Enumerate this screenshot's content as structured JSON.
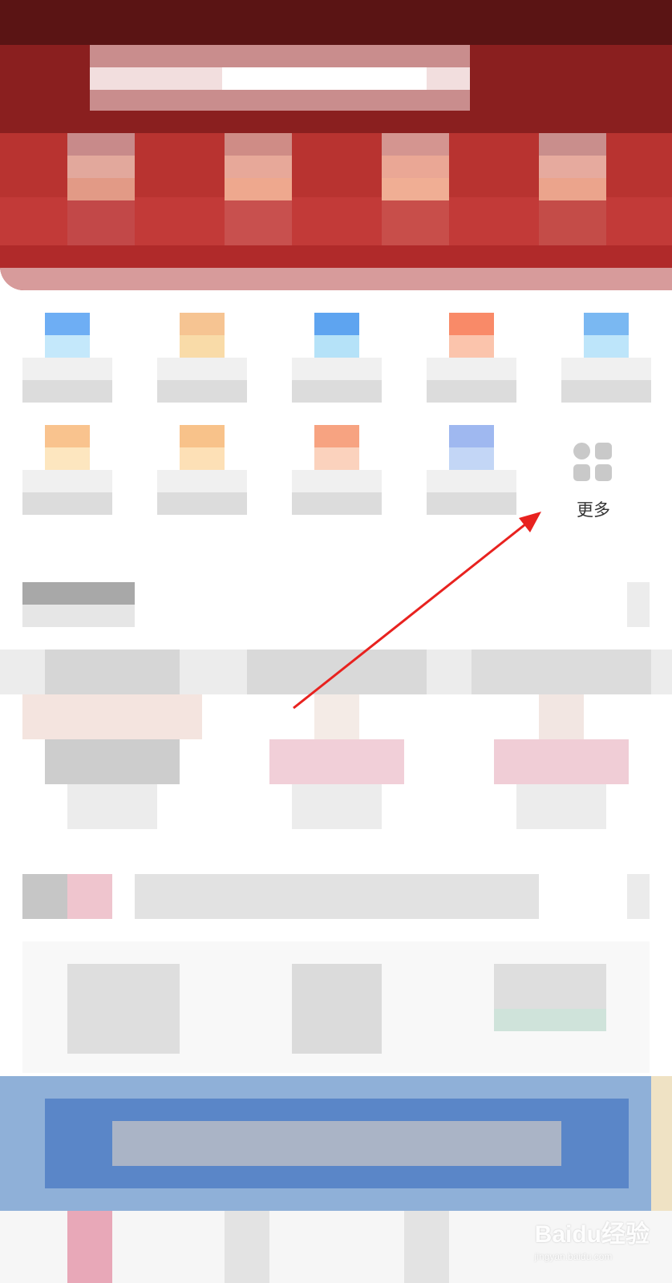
{
  "more": {
    "label": "更多",
    "icon": "grid-apps-icon"
  },
  "annotation": {
    "icon": "red-arrow-icon",
    "color": "#e8221f"
  },
  "watermark": {
    "brand": "Baidu经验",
    "url": "jingyan.baidu.com"
  },
  "colors": {
    "header_red": "#b32c2c",
    "banner_blue": "#5a86c8",
    "more_icon_gray": "#c9c9c9"
  }
}
